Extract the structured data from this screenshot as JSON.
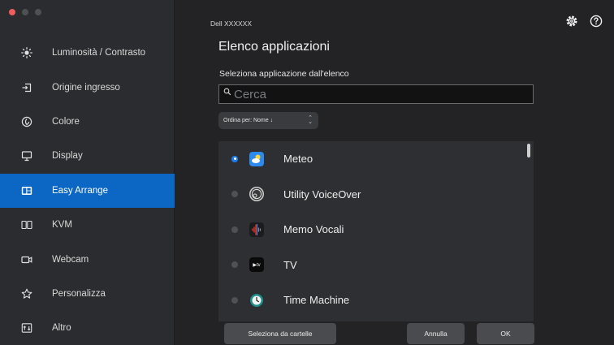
{
  "window": {
    "traffic_lights": [
      "close",
      "minimize",
      "zoom"
    ]
  },
  "sidebar": {
    "items": [
      {
        "label": "Luminosità / Contrasto",
        "icon": "brightness-icon",
        "active": false
      },
      {
        "label": "Origine ingresso",
        "icon": "input-source-icon",
        "active": false
      },
      {
        "label": "Colore",
        "icon": "color-icon",
        "active": false
      },
      {
        "label": "Display",
        "icon": "display-icon",
        "active": false
      },
      {
        "label": "Easy Arrange",
        "icon": "easy-arrange-icon",
        "active": true
      },
      {
        "label": "KVM",
        "icon": "kvm-icon",
        "active": false
      },
      {
        "label": "Webcam",
        "icon": "webcam-icon",
        "active": false
      },
      {
        "label": "Personalizza",
        "icon": "star-icon",
        "active": false
      },
      {
        "label": "Altro",
        "icon": "more-icon",
        "active": false
      }
    ]
  },
  "header": {
    "monitor_name": "Dell XXXXXX",
    "icons": [
      "gear-icon",
      "help-icon"
    ]
  },
  "main": {
    "title": "Elenco applicazioni",
    "subtitle": "Seleziona applicazione dall'elenco",
    "search": {
      "value": "",
      "placeholder": "Cerca"
    },
    "sort": {
      "label": "Ordina per: Nome ↓"
    },
    "apps": [
      {
        "name": "Meteo",
        "selected": true,
        "icon": "weather-icon",
        "icon_color": "#2d8bf0"
      },
      {
        "name": "Utility VoiceOver",
        "selected": false,
        "icon": "voiceover-icon",
        "icon_color": "#d0d0d0"
      },
      {
        "name": "Memo Vocali",
        "selected": false,
        "icon": "voice-memos-icon",
        "icon_color": "#1c1c1e"
      },
      {
        "name": "TV",
        "selected": false,
        "icon": "tv-icon",
        "icon_glyph": "▶tv",
        "icon_color": "#0a0a0a"
      },
      {
        "name": "Time Machine",
        "selected": false,
        "icon": "time-machine-icon",
        "icon_color": "#1f8f8a"
      }
    ]
  },
  "buttons": {
    "folders": "Seleziona da cartelle",
    "cancel": "Annulla",
    "ok": "OK"
  },
  "colors": {
    "accent": "#0c66c4",
    "sidebar_bg": "#2b2c2f",
    "main_bg": "#232325",
    "list_bg": "#2e2f32",
    "radio_on": "#1e7bea",
    "close_light": "#f05d5d"
  }
}
